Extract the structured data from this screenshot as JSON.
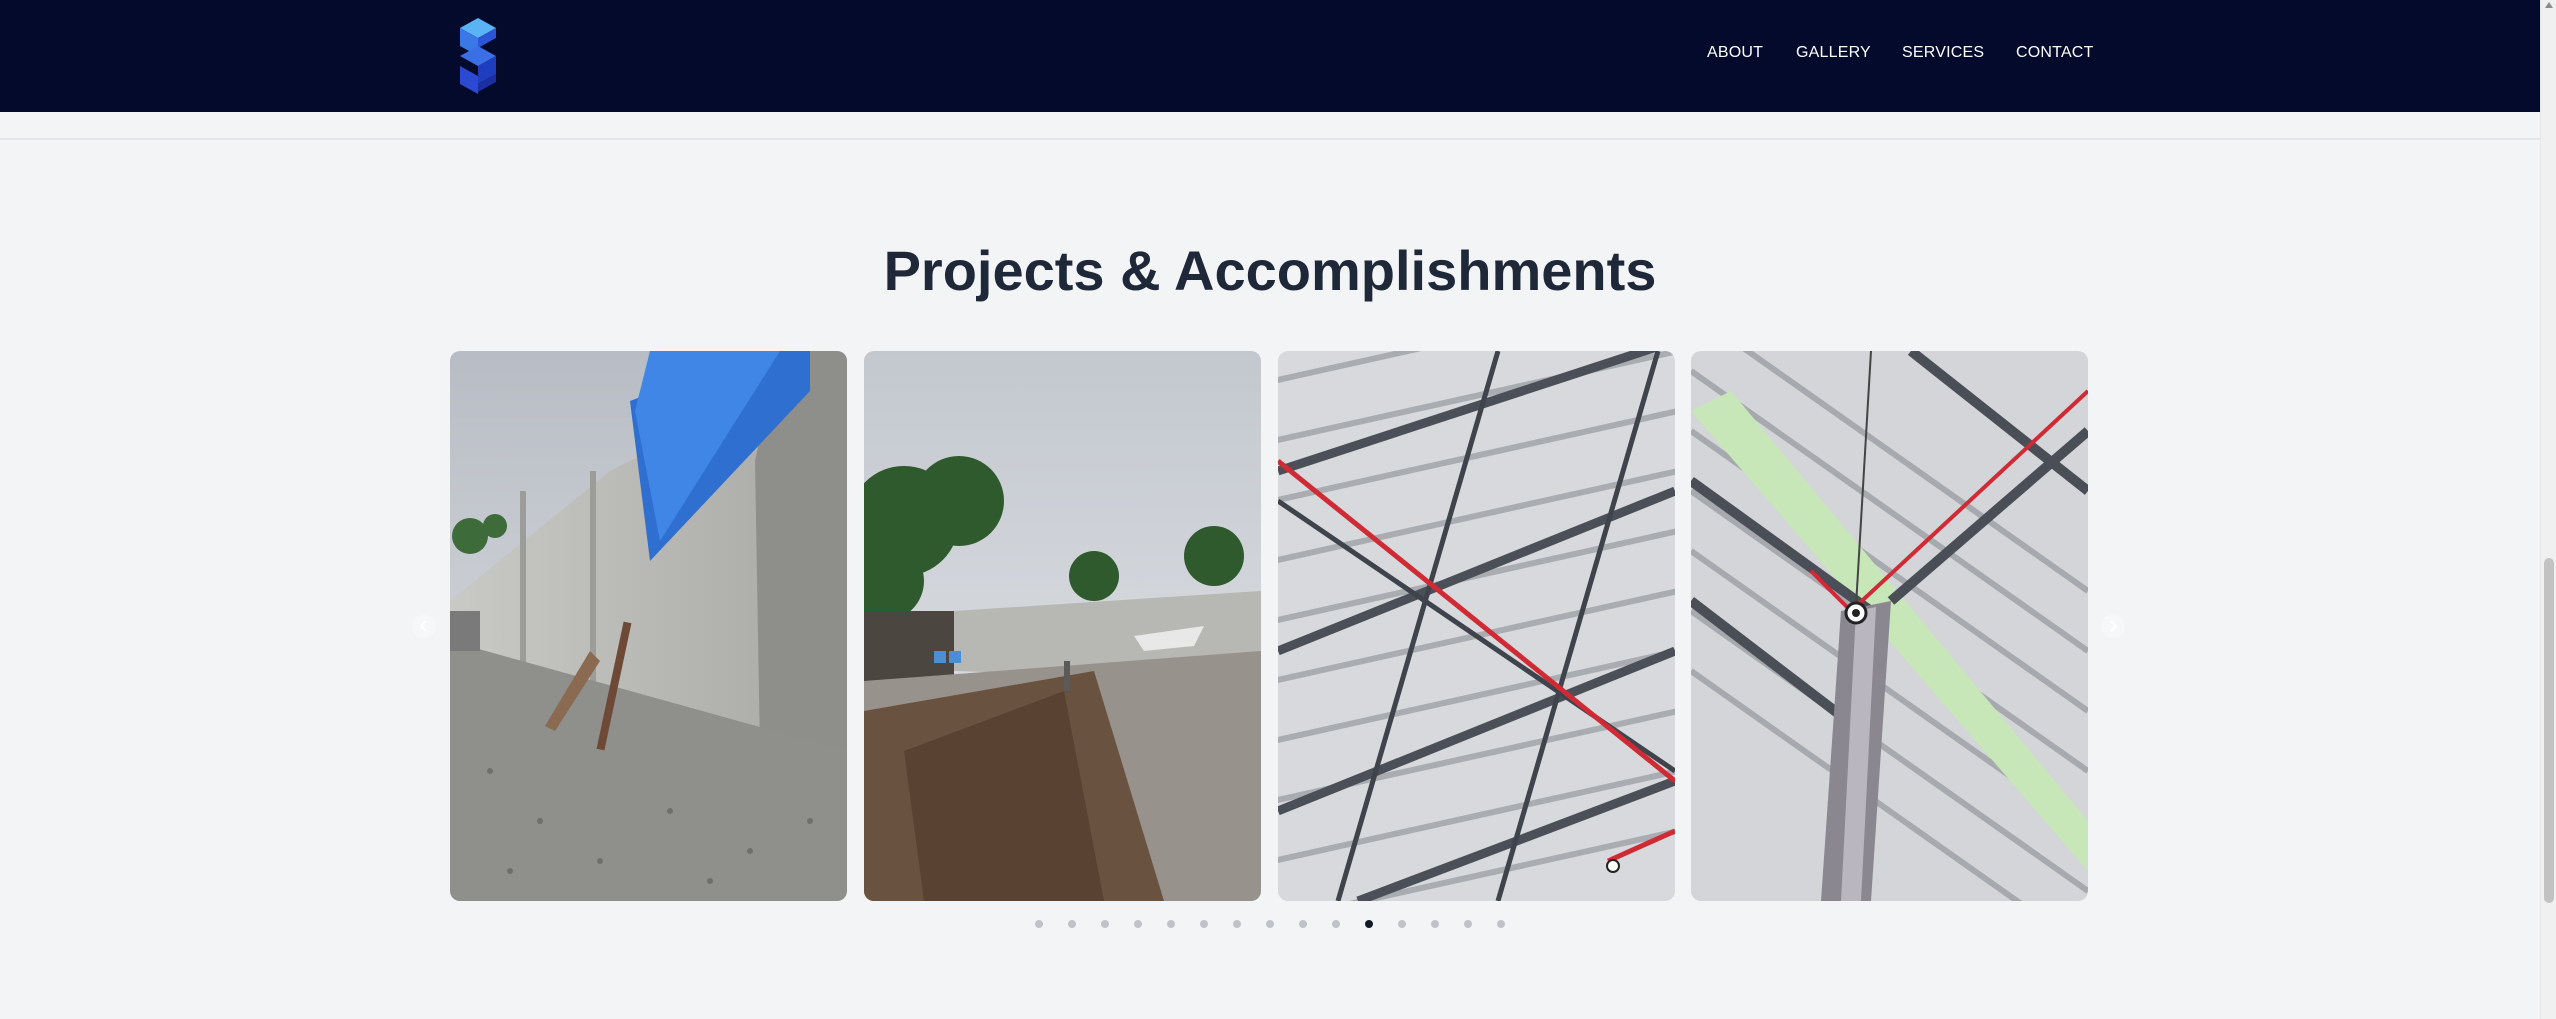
{
  "header": {
    "logo_icon": "cube-s-logo-icon",
    "nav": {
      "about": "ABOUT",
      "gallery": "GALLERY",
      "services": "SERVICES",
      "contact": "CONTACT"
    }
  },
  "section": {
    "title": "Projects & Accomplishments"
  },
  "carousel": {
    "prev_icon": "chevron-left-icon",
    "next_icon": "chevron-right-icon",
    "slide_count": 15,
    "active_index": 10,
    "visible_slides": [
      "Concrete perimeter wall with blue tarp over gravel",
      "Excavated site with soil and gravel inside walled lot",
      "Steel roof trusses with corrugated metal sheets",
      "Steel column and roof framing with red pipe"
    ]
  },
  "colors": {
    "header_bg": "#040a2c",
    "page_bg": "#f3f4f6",
    "title_text": "#1e2838",
    "dot_active": "#111827",
    "dot_inactive": "#bfc3c9"
  }
}
